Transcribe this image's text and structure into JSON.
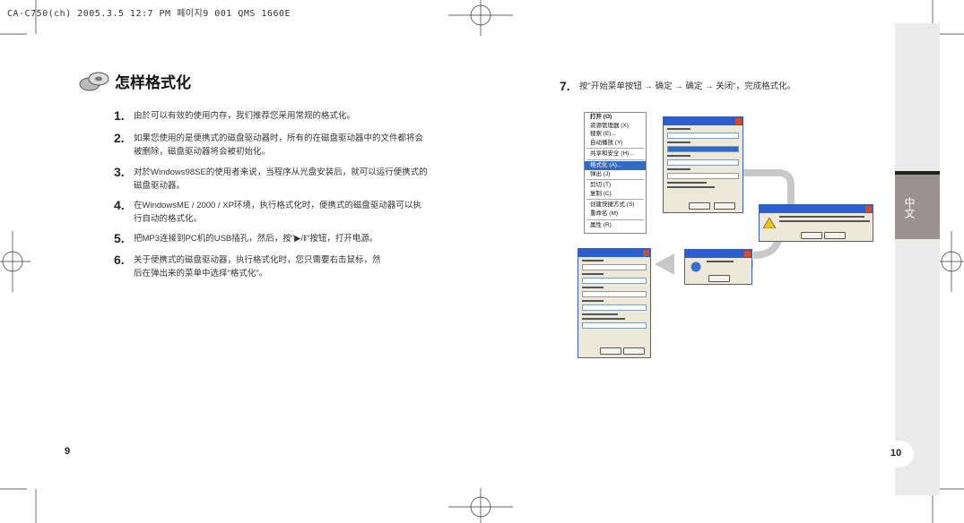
{
  "header": "CA-C750(ch)  2005.3.5 12:7 PM 페이지9   001 QMS 1660E",
  "left_page": {
    "title": "怎样格式化",
    "items": [
      {
        "num": "1.",
        "text": "由於可以有效的使用内存，我们推荐您采用常规的格式化。"
      },
      {
        "num": "2.",
        "text": "如果您使用的是便携式的磁盘驱动器时，所有的在磁盘驱动器中的文件都将会被删除，磁盘驱动器将会被初始化。"
      },
      {
        "num": "3.",
        "text": "对於Windows98SE的使用者来说，当程序从光盘安装后，就可以运行便携式的磁盘驱动器。"
      },
      {
        "num": "4.",
        "text": "在WindowsME / 2000 / XP环境，执行格式化时，便携式的磁盘驱动器可以执行自动的格式化。"
      },
      {
        "num": "5.",
        "text": "把MP3连接到PC机的USB插孔，然后，按\"▶/‖\"按钮，打开电源。"
      },
      {
        "num": "6.",
        "text": "关于便携式的磁盘驱动器，执行格式化时，您只需要右击鼠标，然后在弹出来的菜单中选择\"格式化\"。"
      }
    ],
    "page_number": "9"
  },
  "right_page": {
    "step_num": "7.",
    "step_text": "按\"开始菜单按钮 → 确定 → 确定 → 关闭\"，完成格式化。",
    "context_menu": [
      "打开 (O)",
      "资源管理器 (X)",
      "搜索 (E)...",
      "自动播放 (Y)",
      "共享和安全 (H)...",
      "格式化 (A)...",
      "弹出 (J)",
      "剪切 (T)",
      "复制 (C)",
      "创建快捷方式 (S)",
      "重命名 (M)",
      "属性 (R)"
    ],
    "side_label": "中文",
    "page_number": "10"
  },
  "colors": {
    "side_tab": "#9b9190",
    "sidebar": "#ebebeb",
    "dialog_title": "#2b5fcf",
    "arrow": "#c8c8c8"
  }
}
